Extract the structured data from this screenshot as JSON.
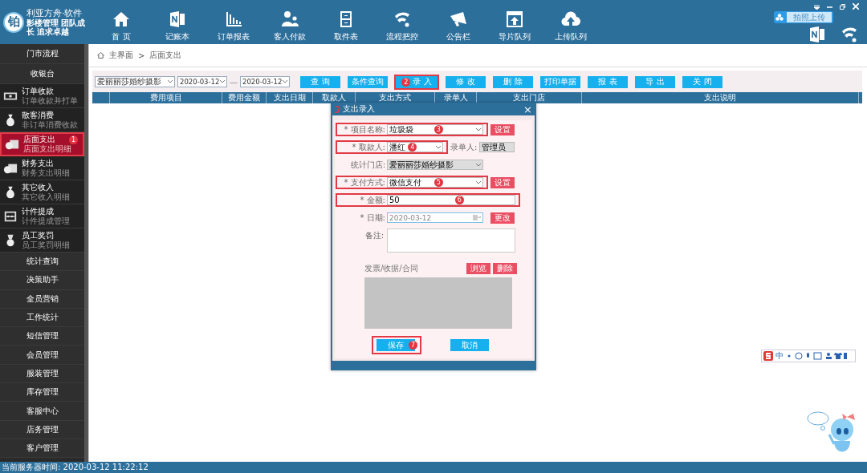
{
  "app": {
    "logo_char": "铂",
    "name": "利亚方舟·软件",
    "tagline": "影楼管理 团队成长 追求卓越"
  },
  "nav": [
    {
      "label": "首 页"
    },
    {
      "label": "记账本"
    },
    {
      "label": "订单报表"
    },
    {
      "label": "客人付款"
    },
    {
      "label": "取件表"
    },
    {
      "label": "流程把控"
    },
    {
      "label": "公告栏"
    },
    {
      "label": "导片队列"
    },
    {
      "label": "上传队列"
    }
  ],
  "upload_button": {
    "label": "拍照上传"
  },
  "sidebar": {
    "items": [
      {
        "kind": "plain",
        "label": "门市流程",
        "selected": false
      },
      {
        "kind": "plain",
        "label": "收银台",
        "selected": false
      },
      {
        "kind": "icon",
        "label": "订单收款",
        "sub": "订单收款并打单",
        "selected": false
      },
      {
        "kind": "icon",
        "label": "散客消费",
        "sub": "非订单消费收款",
        "selected": false
      },
      {
        "kind": "icon",
        "label": "店面支出",
        "sub": "店面支出明细",
        "selected": true,
        "callout": "1"
      },
      {
        "kind": "icon",
        "label": "财务支出",
        "sub": "财务支出明细",
        "selected": false
      },
      {
        "kind": "icon",
        "label": "其它收入",
        "sub": "其它收入明细",
        "selected": false
      },
      {
        "kind": "icon",
        "label": "计件提成",
        "sub": "计件提成管理",
        "selected": false
      },
      {
        "kind": "icon",
        "label": "员工奖罚",
        "sub": "员工奖罚明细",
        "selected": false
      },
      {
        "kind": "plain",
        "label": "统计查询",
        "selected": false
      },
      {
        "kind": "plain",
        "label": "决策助手",
        "selected": false
      },
      {
        "kind": "plain",
        "label": "全员营销",
        "selected": false
      },
      {
        "kind": "plain",
        "label": "工作统计",
        "selected": false
      },
      {
        "kind": "plain",
        "label": "短信管理",
        "selected": false
      },
      {
        "kind": "plain",
        "label": "会员管理",
        "selected": false
      },
      {
        "kind": "plain",
        "label": "服装管理",
        "selected": false
      },
      {
        "kind": "plain",
        "label": "库存管理",
        "selected": false
      },
      {
        "kind": "plain",
        "label": "客服中心",
        "selected": false
      },
      {
        "kind": "plain",
        "label": "店务管理",
        "selected": false
      },
      {
        "kind": "plain",
        "label": "客户管理",
        "selected": false
      }
    ]
  },
  "breadcrumb": {
    "items": [
      "主界面",
      "店面支出"
    ],
    "separator": ">"
  },
  "filter": {
    "store": "爱丽丽莎婚纱摄影",
    "date_from": "2020-03-12",
    "separator": "—",
    "date_to": "2020-03-12"
  },
  "toolbar": [
    {
      "label": "查 询",
      "highlighted": false
    },
    {
      "label": "条件查询",
      "highlighted": false
    },
    {
      "label": "录 入",
      "highlighted": true,
      "callout": "2"
    },
    {
      "label": "修 改",
      "highlighted": false
    },
    {
      "label": "删 除",
      "highlighted": false
    },
    {
      "label": "打印单据",
      "highlighted": false
    },
    {
      "label": "报 表",
      "highlighted": false
    },
    {
      "label": "导 出",
      "highlighted": false
    },
    {
      "label": "关 闭",
      "highlighted": false
    }
  ],
  "table": {
    "columns": [
      "费用项目",
      "费用金额",
      "支出日期",
      "取款人",
      "支出方式",
      "录单人",
      "支出门店",
      "支出说明"
    ]
  },
  "dialog": {
    "title": "支出录入",
    "close": "×",
    "fields": [
      {
        "kind": "select",
        "label": "* 项目名称:",
        "value": "垃圾袋",
        "button": "设置",
        "highlighted": true,
        "callout": "3"
      },
      {
        "kind": "pair",
        "label": "* 取款人:",
        "value": "潘红",
        "side_label": "录单人:",
        "side_value": "管理员",
        "highlighted": true,
        "callout": "4"
      },
      {
        "kind": "select",
        "label": "统计门店:",
        "value": "爱丽丽莎婚纱摄影",
        "disabled": true,
        "highlighted": false
      },
      {
        "kind": "select",
        "label": "* 支付方式:",
        "value": "微信支付",
        "button": "设置",
        "highlighted": true,
        "callout": "5"
      },
      {
        "kind": "text",
        "label": "* 金额:",
        "value": "50",
        "highlighted": true,
        "callout": "6"
      },
      {
        "kind": "date",
        "label": "* 日期:",
        "value": "2020-03-12",
        "button": "更改",
        "highlighted": false
      },
      {
        "kind": "textarea",
        "label": "备注:",
        "highlighted": false
      },
      {
        "kind": "attachment",
        "label": "发票/收据/合同",
        "buttons": [
          "浏览",
          "删除"
        ],
        "highlighted": false
      }
    ],
    "buttons": [
      {
        "label": "保存",
        "highlighted": true,
        "callout": "7"
      },
      {
        "label": "取消",
        "highlighted": false
      }
    ]
  },
  "ime": {
    "label": "中"
  },
  "status_bar": {
    "text": "当前服务器时间: 2020-03-12 11:22:12"
  }
}
